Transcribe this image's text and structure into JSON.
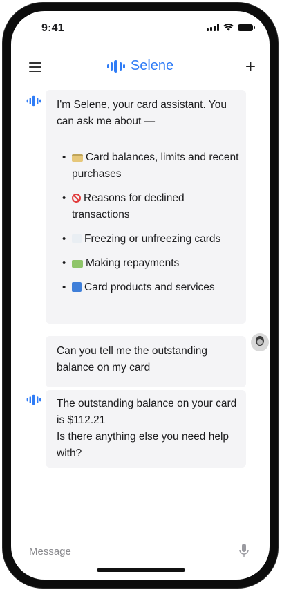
{
  "status_bar": {
    "time": "9:41"
  },
  "header": {
    "app_name": "Selene",
    "brand_color": "#2f7cf6"
  },
  "messages": [
    {
      "sender": "assistant",
      "intro": "I'm Selene, your card assistant. You can ask me about —",
      "items": [
        {
          "icon": "credit-card-icon",
          "label": "Card balances, limits and recent purchases"
        },
        {
          "icon": "no-entry-icon",
          "label": "Reasons for declined transactions"
        },
        {
          "icon": "ice-icon",
          "label": "Freezing or unfreezing cards"
        },
        {
          "icon": "money-icon",
          "label": "Making repayments"
        },
        {
          "icon": "info-icon",
          "label": "Card products and services"
        }
      ]
    },
    {
      "sender": "user",
      "text": "Can you tell me the outstanding balance on my card"
    },
    {
      "sender": "assistant",
      "text_line1": "The outstanding balance on your card is $112.21",
      "text_line2": "Is there anything else you need help with?"
    }
  ],
  "composer": {
    "placeholder": "Message"
  }
}
